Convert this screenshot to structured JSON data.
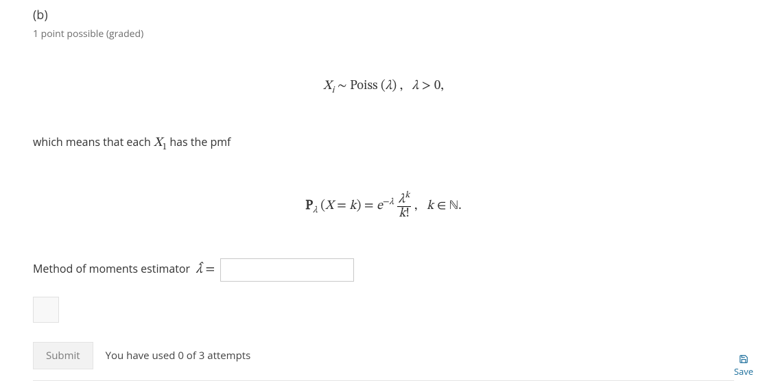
{
  "part_label": "(b)",
  "points_text": "1 point possible (graded)",
  "math1_html": "<i>X</i><span class='sub'><i>i</i></span> ∼ Poiss (<i>λ</i>) ,&nbsp;&nbsp;&nbsp;<i>λ</i> &gt; 0,",
  "prose_prefix": "which means that each ",
  "prose_inline_html": "<i>X</i><span class='sub'>1</span>",
  "prose_suffix": "  has the pmf",
  "math2_html": "<b>P</b><span class='sub'><i>λ</i></span> (<i>X</i> = <i>k</i>) = <i>e</i><span class='sup'>−<i>λ</i></span> <span class='frac'><span class='num'><i>λ</i><span class='sup'><i>k</i></span></span><span class='den'><i>k</i>!</span></span> ,&nbsp;&nbsp;&nbsp;<i>k</i> ∈ <span class='bbd'>ℕ</span>.",
  "input_label_html": "Method of moments estimator &nbsp;<span class='math-inline'><i>λ̂</i> =</span>",
  "answer_value": "",
  "answer_placeholder": "",
  "submit_label": "Submit",
  "attempts_text": "You have used 0 of 3 attempts",
  "save_label": "Save"
}
